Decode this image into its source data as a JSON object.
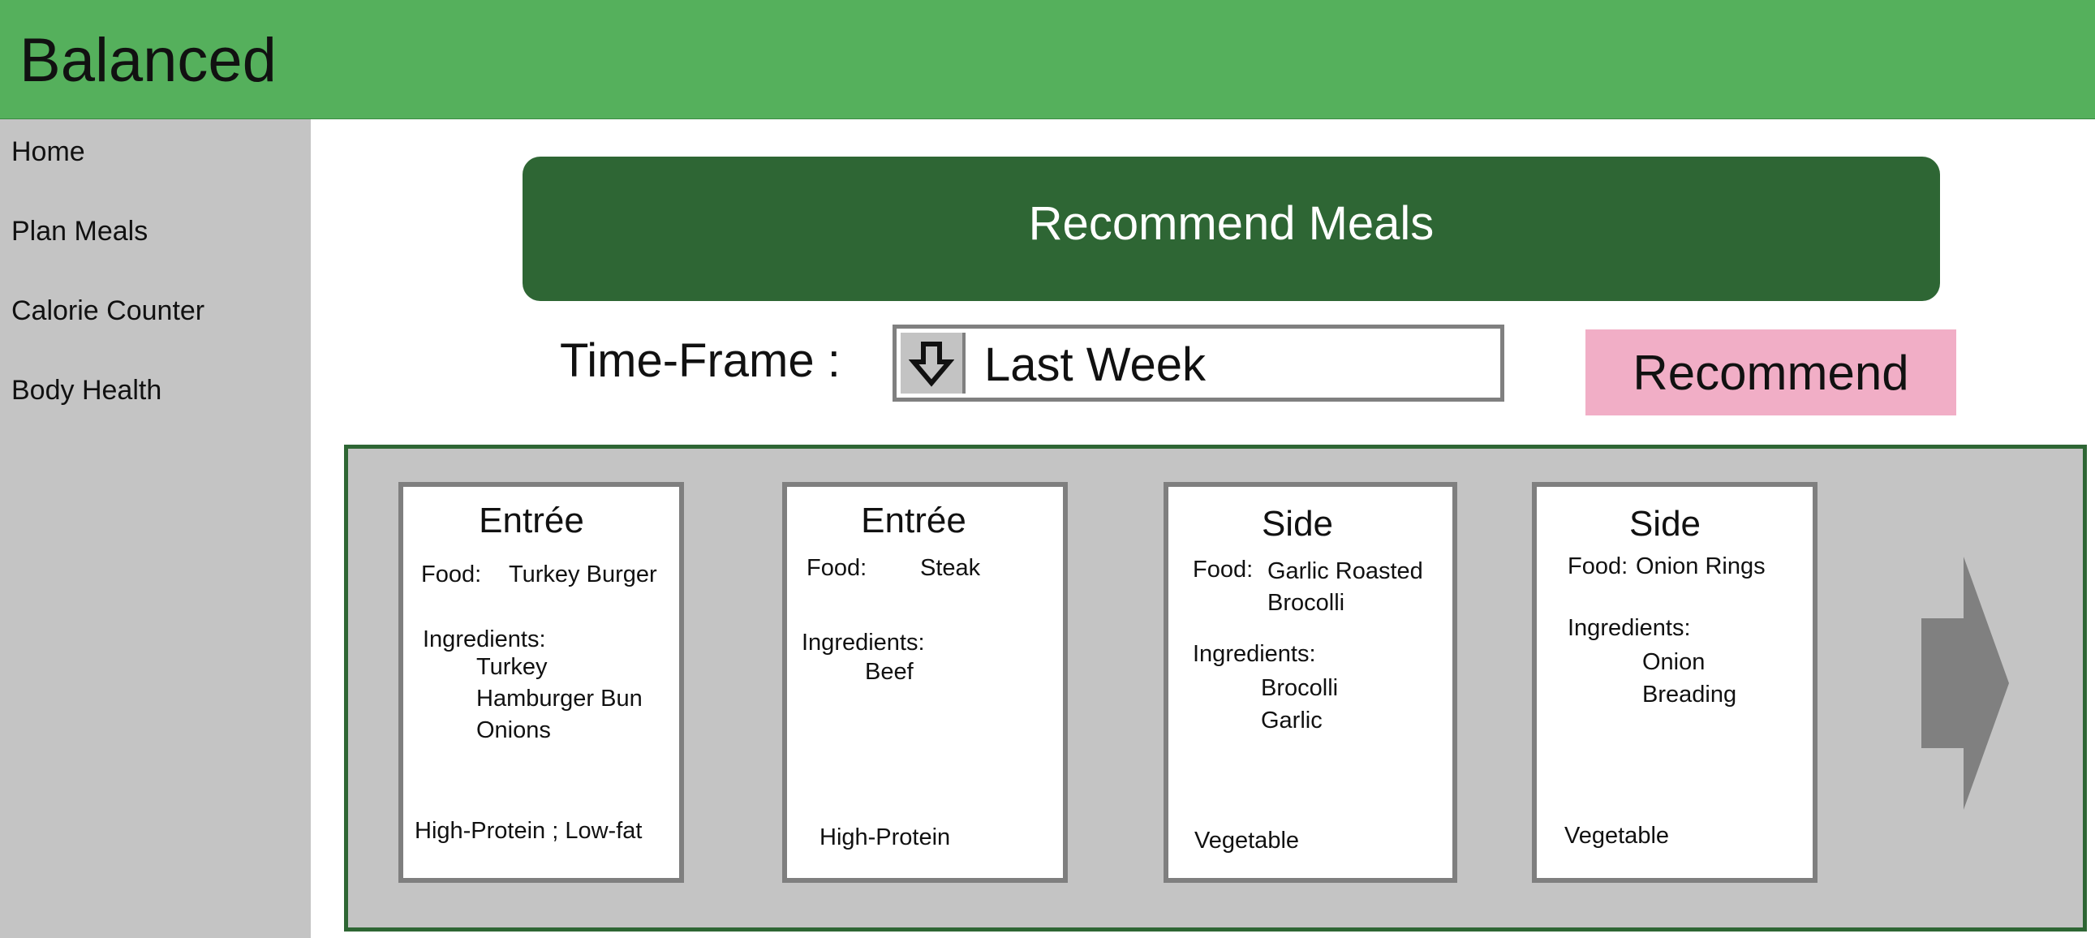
{
  "header": {
    "title": "Balanced",
    "color": "#55b05c"
  },
  "sidebar": {
    "items": [
      {
        "label": "Home"
      },
      {
        "label": "Plan Meals"
      },
      {
        "label": "Calorie Counter"
      },
      {
        "label": "Body Health"
      }
    ]
  },
  "main": {
    "banner_label": "Recommend Meals",
    "timeframe": {
      "label": "Time-Frame :",
      "value": "Last Week",
      "dropdown_icon": "arrow-down-icon"
    },
    "recommend_button": "Recommend",
    "cards": [
      {
        "category": "Entrée",
        "food_label": "Food:",
        "food": "Turkey Burger",
        "ingredients_label": "Ingredients:",
        "ingredients": [
          "Turkey",
          "Hamburger Bun",
          "Onions"
        ],
        "tags": "High-Protein ; Low-fat"
      },
      {
        "category": "Entrée",
        "food_label": "Food:",
        "food": "Steak",
        "ingredients_label": "Ingredients:",
        "ingredients": [
          "Beef"
        ],
        "tags": "High-Protein"
      },
      {
        "category": "Side",
        "food_label": "Food:",
        "food_lines": [
          "Garlic Roasted",
          "Brocolli"
        ],
        "ingredients_label": "Ingredients:",
        "ingredients": [
          "Brocolli",
          "Garlic"
        ],
        "tags": "Vegetable"
      },
      {
        "category": "Side",
        "food_label": "Food:",
        "food": "Onion Rings",
        "ingredients_label": "Ingredients:",
        "ingredients": [
          "Onion",
          "Breading"
        ],
        "tags": "Vegetable"
      }
    ],
    "next_icon": "arrow-right-icon"
  },
  "colors": {
    "banner": "#2e6634",
    "recommend_button": "#f1aec6",
    "sidebar": "#c4c4c4",
    "card_border": "#7f7f7f"
  }
}
